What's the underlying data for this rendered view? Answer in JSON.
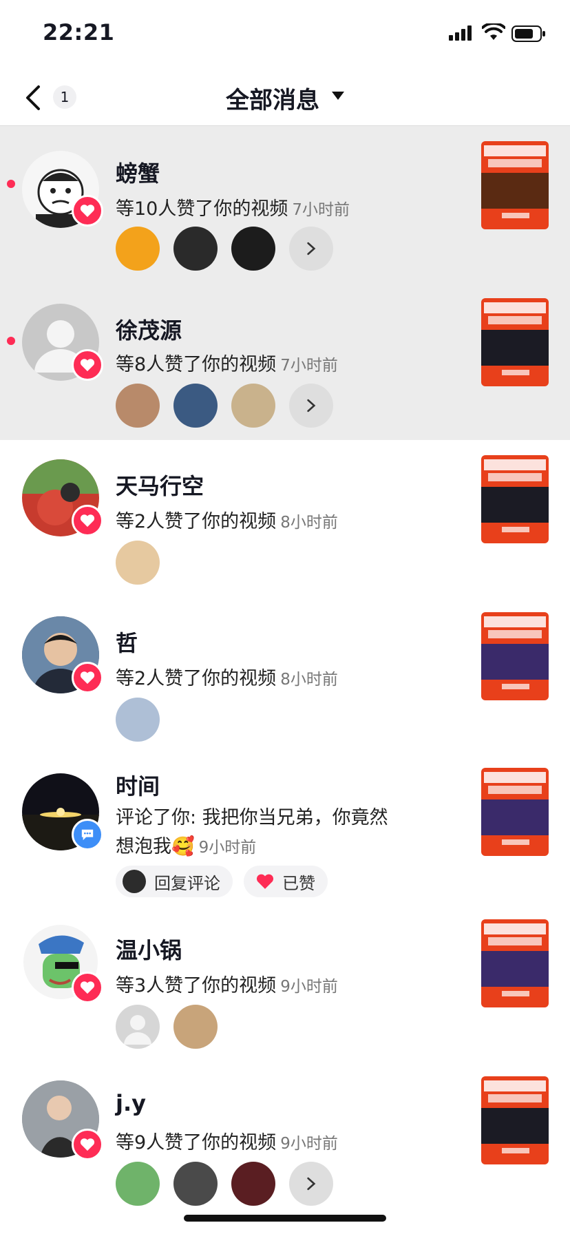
{
  "status_bar": {
    "time": "22:21"
  },
  "nav": {
    "back_count": "1",
    "title": "全部消息"
  },
  "colors": {
    "accent": "#fe2c55",
    "comment_badge": "#3d8ef7",
    "thumbnail_red": "#e8401b"
  },
  "notifications": [
    {
      "name": "螃蟹",
      "unread": true,
      "badge": "heart-icon",
      "action": "等10人赞了你的视频",
      "time": "7小时前",
      "likers_count": 3,
      "has_more": true
    },
    {
      "name": "徐茂源",
      "unread": true,
      "badge": "heart-icon",
      "action": "等8人赞了你的视频",
      "time": "7小时前",
      "likers_count": 3,
      "has_more": true
    },
    {
      "name": "天马行空",
      "unread": false,
      "badge": "heart-icon",
      "action": "等2人赞了你的视频",
      "time": "8小时前",
      "likers_count": 1,
      "has_more": false
    },
    {
      "name": "哲",
      "unread": false,
      "badge": "heart-icon",
      "action": "等2人赞了你的视频",
      "time": "8小时前",
      "likers_count": 1,
      "has_more": false
    },
    {
      "name": "时间",
      "unread": false,
      "badge": "comment-icon",
      "comment_line1": "评论了你: 我把你当兄弟，你竟然",
      "comment_line2": "想泡我🥰",
      "time": "9小时前",
      "reply_label": "回复评论",
      "liked_label": "已赞"
    },
    {
      "name": "温小锅",
      "unread": false,
      "badge": "heart-icon",
      "action": "等3人赞了你的视频",
      "time": "9小时前",
      "likers_count": 2,
      "has_more": false
    },
    {
      "name": "j.y",
      "unread": false,
      "badge": "heart-icon",
      "action": "等9人赞了你的视频",
      "time": "9小时前",
      "likers_count": 3,
      "has_more": true
    }
  ]
}
